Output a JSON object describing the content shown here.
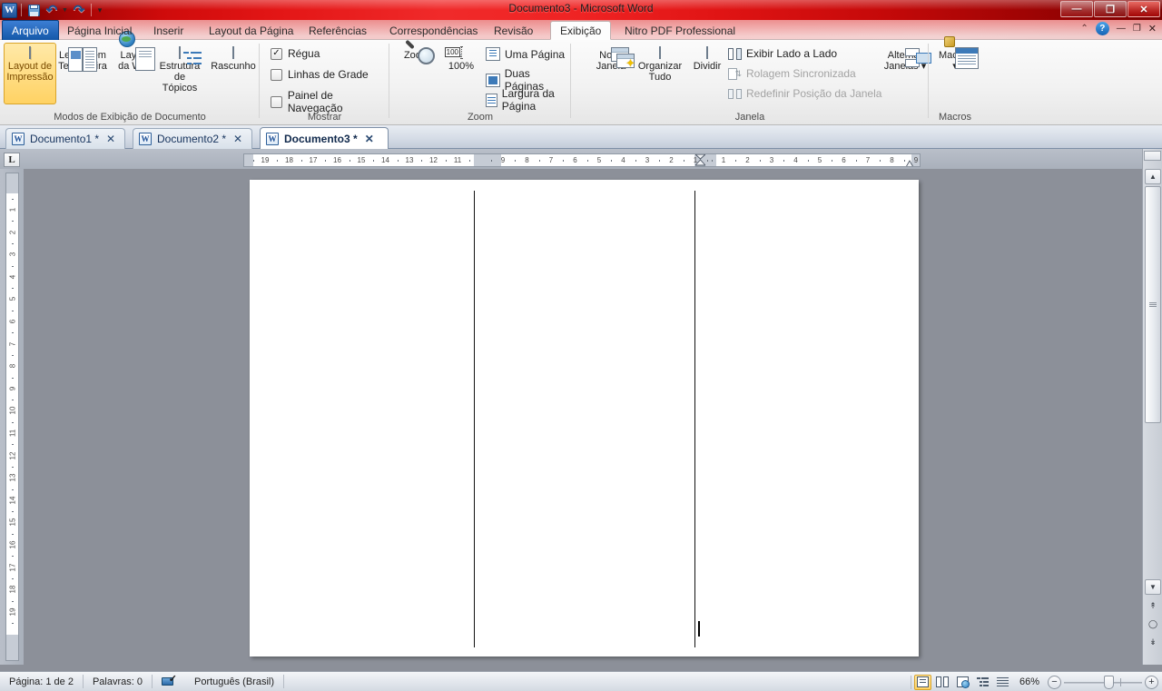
{
  "titlebar": {
    "app_icon": "word-logo-icon",
    "title": "Documento3  -  Microsoft Word",
    "quick_access": [
      {
        "name": "save",
        "icon": "save-icon"
      },
      {
        "name": "undo",
        "icon": "undo-icon"
      },
      {
        "name": "redo",
        "icon": "redo-icon"
      },
      {
        "name": "customize",
        "icon": "chevron-down-icon"
      }
    ],
    "window_buttons": [
      {
        "name": "minimize",
        "label": "—"
      },
      {
        "name": "restore",
        "label": "❐"
      },
      {
        "name": "close",
        "label": "✕"
      }
    ],
    "accent_color": "#e31616"
  },
  "ribbon_tabs": {
    "file_tab": "Arquivo",
    "items": [
      {
        "label": "Página Inicial",
        "active": false
      },
      {
        "label": "Inserir",
        "active": false
      },
      {
        "label": "Layout da Página",
        "active": false
      },
      {
        "label": "Referências",
        "active": false
      },
      {
        "label": "Correspondências",
        "active": false
      },
      {
        "label": "Revisão",
        "active": false
      },
      {
        "label": "Exibição",
        "active": true
      },
      {
        "label": "Nitro PDF Professional",
        "active": false
      }
    ],
    "right_controls": [
      {
        "name": "minimize-ribbon",
        "label": "⌃"
      },
      {
        "name": "help",
        "label": "?"
      },
      {
        "name": "doc-minimize",
        "label": "—"
      },
      {
        "name": "doc-restore",
        "label": "❐"
      },
      {
        "name": "doc-close",
        "label": "✕"
      }
    ]
  },
  "ribbon": {
    "groups": [
      {
        "name": "document-views",
        "label": "Modos de Exibição de Documento",
        "buttons": [
          {
            "label_line1": "Layout de",
            "label_line2": "Impressão",
            "icon": "print-layout-icon",
            "selected": true
          },
          {
            "label_line1": "Leitura em",
            "label_line2": "Tela Inteira",
            "icon": "full-screen-reading-icon",
            "selected": false
          },
          {
            "label_line1": "Layout",
            "label_line2": "da Web",
            "icon": "web-layout-icon",
            "selected": false
          },
          {
            "label_line1": "Estrutura",
            "label_line2": "de Tópicos",
            "icon": "outline-icon",
            "selected": false
          },
          {
            "label_line1": "Rascunho",
            "label_line2": "",
            "icon": "draft-icon",
            "selected": false
          }
        ]
      },
      {
        "name": "show",
        "label": "Mostrar",
        "checkboxes": [
          {
            "label": "Régua",
            "checked": true
          },
          {
            "label": "Linhas de Grade",
            "checked": false
          },
          {
            "label": "Painel de Navegação",
            "checked": false
          }
        ]
      },
      {
        "name": "zoom",
        "label": "Zoom",
        "buttons": [
          {
            "label": "Zoom",
            "icon": "magnifier-icon"
          },
          {
            "label": "100%",
            "icon": "zoom-100-icon"
          }
        ],
        "small_items": [
          {
            "label": "Uma Página",
            "icon": "one-page-icon"
          },
          {
            "label": "Duas Páginas",
            "icon": "two-pages-icon"
          },
          {
            "label": "Largura da Página",
            "icon": "page-width-icon"
          }
        ]
      },
      {
        "name": "window",
        "label": "Janela",
        "buttons": [
          {
            "label_line1": "Nova",
            "label_line2": "Janela",
            "icon": "new-window-icon"
          },
          {
            "label_line1": "Organizar",
            "label_line2": "Tudo",
            "icon": "arrange-all-icon"
          },
          {
            "label_line1": "Dividir",
            "label_line2": "",
            "icon": "split-icon"
          }
        ],
        "small_items": [
          {
            "label": "Exibir Lado a Lado",
            "icon": "view-side-by-side-icon",
            "disabled": false
          },
          {
            "label": "Rolagem Sincronizada",
            "icon": "synchronous-scrolling-icon",
            "disabled": true
          },
          {
            "label": "Redefinir Posição da Janela",
            "icon": "reset-window-position-icon",
            "disabled": true
          }
        ],
        "switch_button": {
          "label_line1": "Alternar",
          "label_line2": "Janelas ▾",
          "icon": "switch-windows-icon"
        }
      },
      {
        "name": "macros",
        "label": "Macros",
        "buttons": [
          {
            "label_line1": "Macros",
            "label_line2": "▾",
            "icon": "macros-icon"
          }
        ]
      }
    ]
  },
  "document_tabs": [
    {
      "label": "Documento1  *",
      "active": false,
      "close": "✕",
      "icon": "word-doc-icon"
    },
    {
      "label": "Documento2  *",
      "active": false,
      "close": "✕",
      "icon": "word-doc-icon"
    },
    {
      "label": "Documento3  *",
      "active": true,
      "close": "✕",
      "icon": "word-doc-icon"
    }
  ],
  "rulers": {
    "tab_selector": "L",
    "horizontal_numbers_left": [
      "19",
      "18",
      "17",
      "16",
      "15",
      "14",
      "13",
      "12",
      "11"
    ],
    "horizontal_numbers_mid": [
      "9",
      "8",
      "7",
      "6",
      "5",
      "4",
      "3",
      "2",
      "1"
    ],
    "horizontal_numbers_right": [
      "1",
      "2",
      "3",
      "4",
      "5",
      "6",
      "7",
      "8",
      "9"
    ],
    "vertical_numbers": [
      "1",
      "2",
      "3",
      "4",
      "5",
      "6",
      "7",
      "8",
      "9",
      "10",
      "11",
      "12",
      "13",
      "14",
      "15",
      "16",
      "17",
      "18",
      "19"
    ]
  },
  "document": {
    "columns": 3,
    "page_background": "#ffffff",
    "canvas_background": "#8c9099",
    "caret_visible": true
  },
  "statusbar": {
    "page_info": "Página: 1 de 2",
    "word_count": "Palavras: 0",
    "language": "Português (Brasil)",
    "proofing_icon": "spell-check-icon",
    "view_buttons": [
      {
        "name": "print-layout",
        "icon": "print-layout-icon",
        "selected": true
      },
      {
        "name": "full-screen-reading",
        "icon": "full-screen-reading-icon",
        "selected": false
      },
      {
        "name": "web-layout",
        "icon": "web-layout-icon",
        "selected": false
      },
      {
        "name": "outline",
        "icon": "outline-icon",
        "selected": false
      },
      {
        "name": "draft",
        "icon": "draft-icon",
        "selected": false
      }
    ],
    "zoom_level": "66%",
    "zoom_out_label": "−",
    "zoom_in_label": "+"
  }
}
